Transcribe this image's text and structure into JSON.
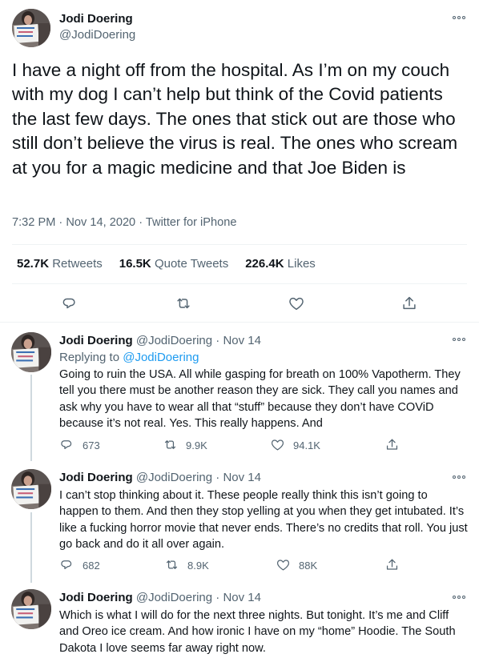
{
  "main_tweet": {
    "author_name": "Jodi Doering",
    "author_handle": "@JodiDoering",
    "text": "I have a night off from the hospital. As I’m on my couch with my dog I can’t help but think of the Covid patients the last few days. The ones that stick out are those who still don’t believe the virus is real. The ones who scream at you for a magic medicine and that Joe Biden is",
    "time": "7:32 PM",
    "date": "Nov 14, 2020",
    "source": "Twitter for iPhone",
    "separator": "·",
    "retweets": "52.7K",
    "retweets_label": "Retweets",
    "quote_tweets": "16.5K",
    "quote_tweets_label": "Quote Tweets",
    "likes": "226.4K",
    "likes_label": "Likes"
  },
  "replies": [
    {
      "author_name": "Jodi Doering",
      "author_handle": "@JodiDoering",
      "date": "Nov 14",
      "replying_to_label": "Replying to",
      "replying_to_handle": "@JodiDoering",
      "text": "Going to ruin the USA. All while gasping for breath on 100% Vapotherm.  They tell you there must be another reason they are sick. They call you names and ask why you have to wear all that “stuff” because they don’t have COViD because it’s not real. Yes. This really happens. And",
      "replies": "673",
      "retweets": "9.9K",
      "likes": "94.1K"
    },
    {
      "author_name": "Jodi Doering",
      "author_handle": "@JodiDoering",
      "date": "Nov 14",
      "text": "I can’t stop thinking about it. These people really think this isn’t going to happen to them.  And then they stop yelling at you when they get intubated. It’s like a fucking horror movie that never ends. There’s no credits that roll. You just go back and do it all over again.",
      "replies": "682",
      "retweets": "8.9K",
      "likes": "88K"
    },
    {
      "author_name": "Jodi Doering",
      "author_handle": "@JodiDoering",
      "date": "Nov 14",
      "text": "Which is what I will do for the next three nights. But tonight. It’s me and Cliff and Oreo ice cream. And how ironic I have on my “home” Hoodie. The South Dakota I love seems far away right now."
    }
  ],
  "icons": {
    "reply": "reply-icon",
    "retweet": "retweet-icon",
    "like": "heart-icon",
    "share": "share-icon",
    "more": "more-icon"
  },
  "colors": {
    "text": "#0f1419",
    "muted": "#536471",
    "link": "#1d9bf0",
    "divider": "#eff3f4"
  }
}
